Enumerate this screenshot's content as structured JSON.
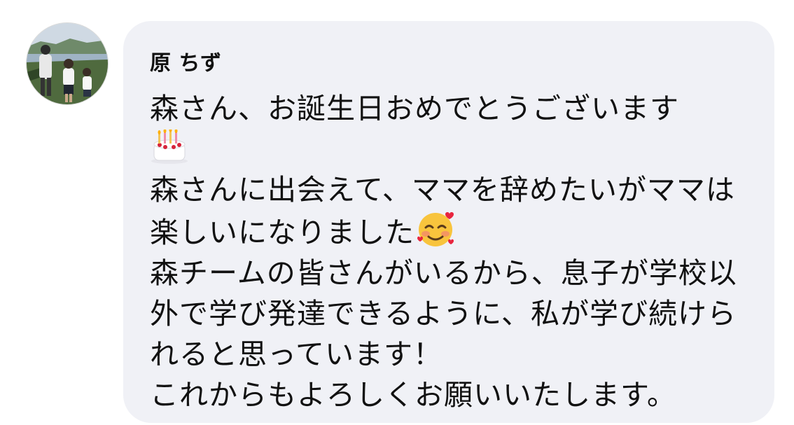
{
  "message": {
    "sender_name": "原 ちず",
    "lines": [
      "森さん、お誕生日おめでとうございます",
      "森さんに出会えて、ママを辞めたいがママは楽しいになりました",
      "森チームの皆さんがいるから、息子が学校以外で学び発達できるように、私が学び続けられると思っています！",
      "これからもよろしくお願いいたします。"
    ],
    "emojis": [
      "birthday-cake",
      "smiling-face-with-hearts"
    ]
  }
}
